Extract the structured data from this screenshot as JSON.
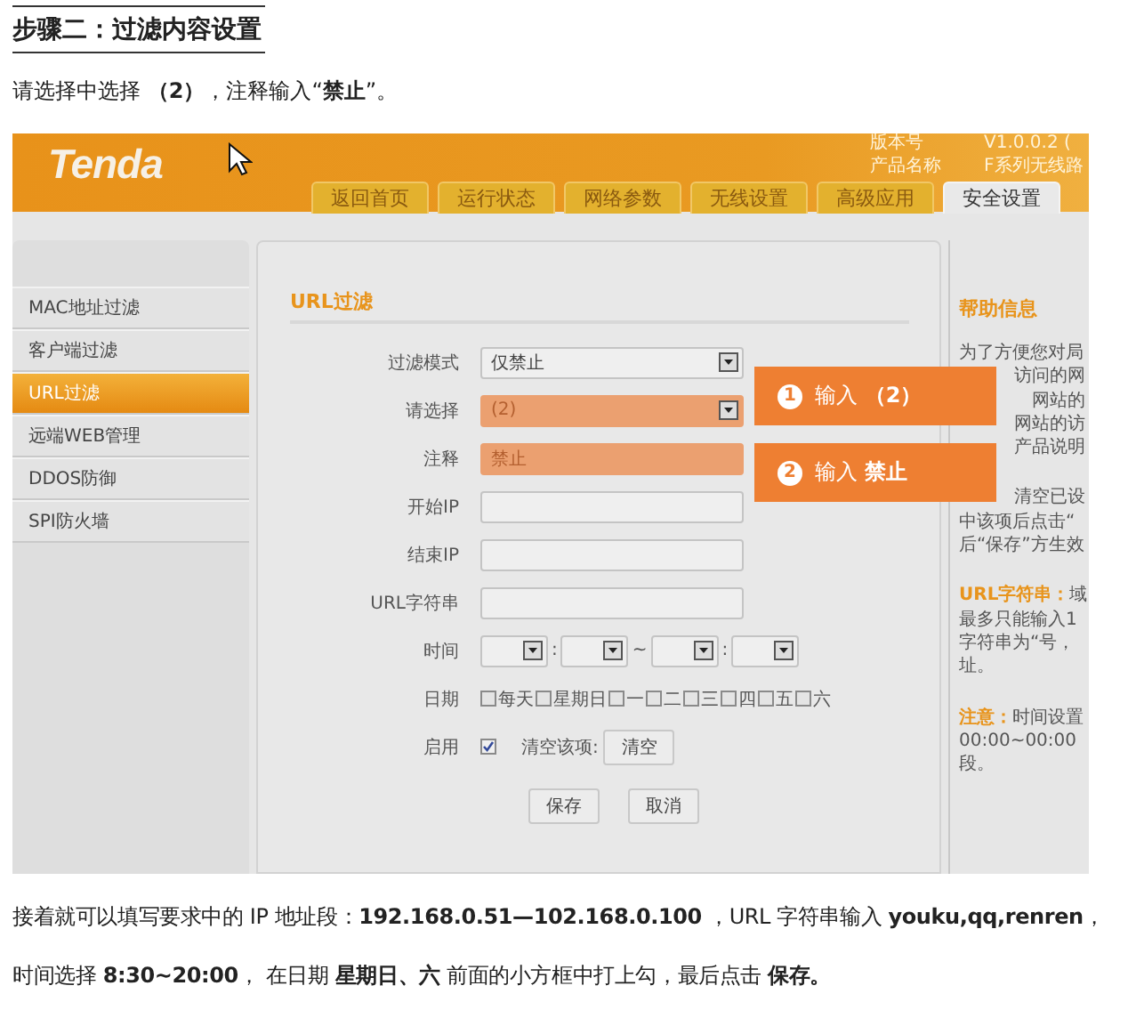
{
  "heading": "步骤二：过滤内容设置",
  "intro": "请选择中选择 **（2）**，注释输入“**禁止**”。",
  "router": {
    "logo": "Tenda",
    "info": [
      {
        "label": "版本号",
        "value": "V1.0.0.2 ("
      },
      {
        "label": "产品名称",
        "value": "F系列无线路"
      }
    ],
    "tabs": [
      {
        "label": "返回首页",
        "selected": false
      },
      {
        "label": "运行状态",
        "selected": false
      },
      {
        "label": "网络参数",
        "selected": false
      },
      {
        "label": "无线设置",
        "selected": false
      },
      {
        "label": "高级应用",
        "selected": false
      },
      {
        "label": "安全设置",
        "selected": true
      }
    ],
    "sidebar": {
      "items": [
        {
          "label": "MAC地址过滤",
          "selected": false
        },
        {
          "label": "客户端过滤",
          "selected": false
        },
        {
          "label": "URL过滤",
          "selected": true
        },
        {
          "label": "远端WEB管理",
          "selected": false
        },
        {
          "label": "DDOS防御",
          "selected": false
        },
        {
          "label": "SPI防火墙",
          "selected": false
        }
      ]
    },
    "panel": {
      "title": "URL过滤",
      "fields": [
        {
          "kind": "select",
          "label": "过滤模式",
          "value": "仅禁止",
          "highlighted": false
        },
        {
          "kind": "select",
          "label": "请选择",
          "value": "(2)",
          "highlighted": true
        },
        {
          "kind": "text",
          "label": "注释",
          "value": "禁止",
          "highlighted": true
        },
        {
          "kind": "text",
          "label": "开始IP",
          "highlighted": false
        },
        {
          "kind": "text",
          "label": "结束IP",
          "highlighted": false
        },
        {
          "kind": "text",
          "label": "URL字符串",
          "highlighted": false
        },
        {
          "kind": "time",
          "label": "时间",
          "separators": [
            ":",
            "~",
            ":"
          ]
        },
        {
          "kind": "days",
          "label": "日期",
          "options": [
            {
              "label": "每天",
              "checked": false
            },
            {
              "label": "星期日",
              "checked": false
            },
            {
              "label": "一",
              "checked": false
            },
            {
              "label": "二",
              "checked": false
            },
            {
              "label": "三",
              "checked": false
            },
            {
              "label": "四",
              "checked": false
            },
            {
              "label": "五",
              "checked": false
            },
            {
              "label": "六",
              "checked": false
            }
          ]
        },
        {
          "kind": "enable",
          "label": "启用",
          "checked": true,
          "clear_label": "清空该项:",
          "clear_button": "清空"
        }
      ],
      "buttons": [
        "保存",
        "取消"
      ]
    },
    "help": {
      "title": "帮助信息",
      "paragraphs": [
        {
          "lines": [
            {
              "kind": "full",
              "text": "为了方便您对局"
            },
            {
              "kind": "partial",
              "text": "访问的网"
            },
            {
              "kind": "partial",
              "text": "网站的"
            },
            {
              "kind": "partial",
              "text": "网站的访"
            },
            {
              "kind": "partial",
              "text": "产品说明"
            }
          ]
        },
        {
          "lines": [
            {
              "kind": "partial",
              "text": "清空已设"
            },
            {
              "kind": "full",
              "text": "中该项后点击“"
            },
            {
              "kind": "full",
              "text": "后“保存”方生效"
            }
          ]
        },
        {
          "lines": [
            {
              "kind": "full",
              "lead": "URL字符串：",
              "text": "域"
            },
            {
              "kind": "full",
              "text": "最多只能输入1"
            },
            {
              "kind": "full",
              "text": "字符串为“号，"
            },
            {
              "kind": "full",
              "text": "址。"
            }
          ]
        },
        {
          "lines": [
            {
              "kind": "full",
              "lead": "注意：",
              "text": "时间设置"
            },
            {
              "kind": "full",
              "text": "00:00~00:00"
            },
            {
              "kind": "full",
              "text": "段。"
            }
          ]
        }
      ]
    },
    "callouts": [
      {
        "number": "1",
        "text": "输入 **（2）**"
      },
      {
        "number": "2",
        "text": "输入 **禁止**"
      }
    ]
  },
  "paragraphs": [
    "接着就可以填写要求中的 IP 地址段：**192.168.0.51—102.168.0.100** ，URL 字符串输入 **youku,qq,renren**，",
    "时间选择 **8:30~20:00**， 在日期 **星期日、六** 前面的小方框中打上勾，最后点击 **保存。**"
  ]
}
